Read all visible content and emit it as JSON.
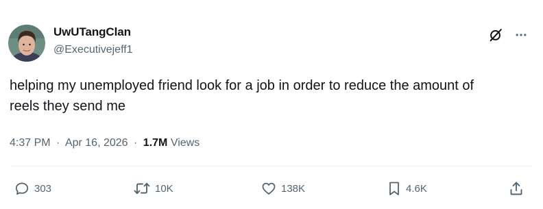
{
  "author": {
    "display_name": "UwUTangClan",
    "handle": "@Executivejeff1",
    "avatar_icon": "profile-photo"
  },
  "tweet": {
    "text": "helping my unemployed friend look for a job in order to reduce the amount of reels they send me"
  },
  "meta": {
    "time": "4:37 PM",
    "separator": "·",
    "date": "Apr 16, 2026",
    "views_count": "1.7M",
    "views_label": "Views"
  },
  "actions": {
    "replies": "303",
    "reposts": "10K",
    "likes": "138K",
    "bookmarks": "4.6K"
  },
  "icons": {
    "grok": "grok-icon",
    "more": "more-icon",
    "reply": "reply-icon",
    "repost": "repost-icon",
    "like": "heart-icon",
    "bookmark": "bookmark-icon",
    "share": "share-icon"
  },
  "colors": {
    "text_primary": "#0f1419",
    "text_secondary": "#536471",
    "divider": "#eff3f4"
  }
}
